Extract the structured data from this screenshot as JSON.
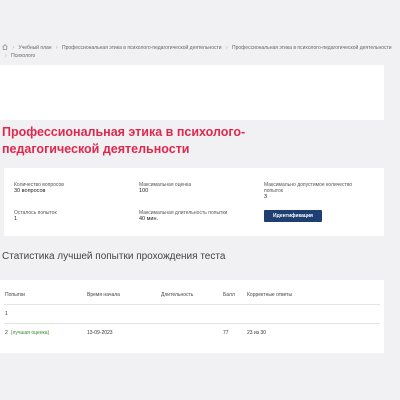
{
  "breadcrumb": {
    "items": [
      "Учебный план",
      "Профессиональная этика в психолого-педагогической деятельности",
      "Профессиональная этика в психолого-педагогической деятельности",
      "Психолого"
    ]
  },
  "title": "Профессиональная этика в психолого-педагогической деятельности",
  "info": {
    "questions_label": "Количество вопросов",
    "questions_value": "30 вопросов",
    "max_score_label": "Максимальная оценка",
    "max_score_value": "100",
    "max_attempts_label": "Максимально допустимое количество попыток",
    "max_attempts_value": "3",
    "remaining_label": "Осталось попыток",
    "remaining_value": "1",
    "max_duration_label": "Максимальная длительность попытки",
    "max_duration_value": "40 мин.",
    "ident_button": "Идентификация"
  },
  "stats_heading": "Статистика лучшей попытки прохождения теста",
  "table": {
    "headers": [
      "Попытки",
      "Время начала",
      "Длительность",
      "Балл",
      "Корректные ответы"
    ],
    "rows": [
      {
        "attempt": "1",
        "best": "",
        "start": "",
        "duration": "",
        "score": "",
        "correct": ""
      },
      {
        "attempt": "2",
        "best": "(лучшая оценка)",
        "start": "13-09-2023",
        "duration": "",
        "score": "77",
        "correct": "23 из 30"
      }
    ]
  },
  "colors": {
    "title": "#e0284f",
    "button": "#1f3f73",
    "best": "#3a8a2f"
  }
}
